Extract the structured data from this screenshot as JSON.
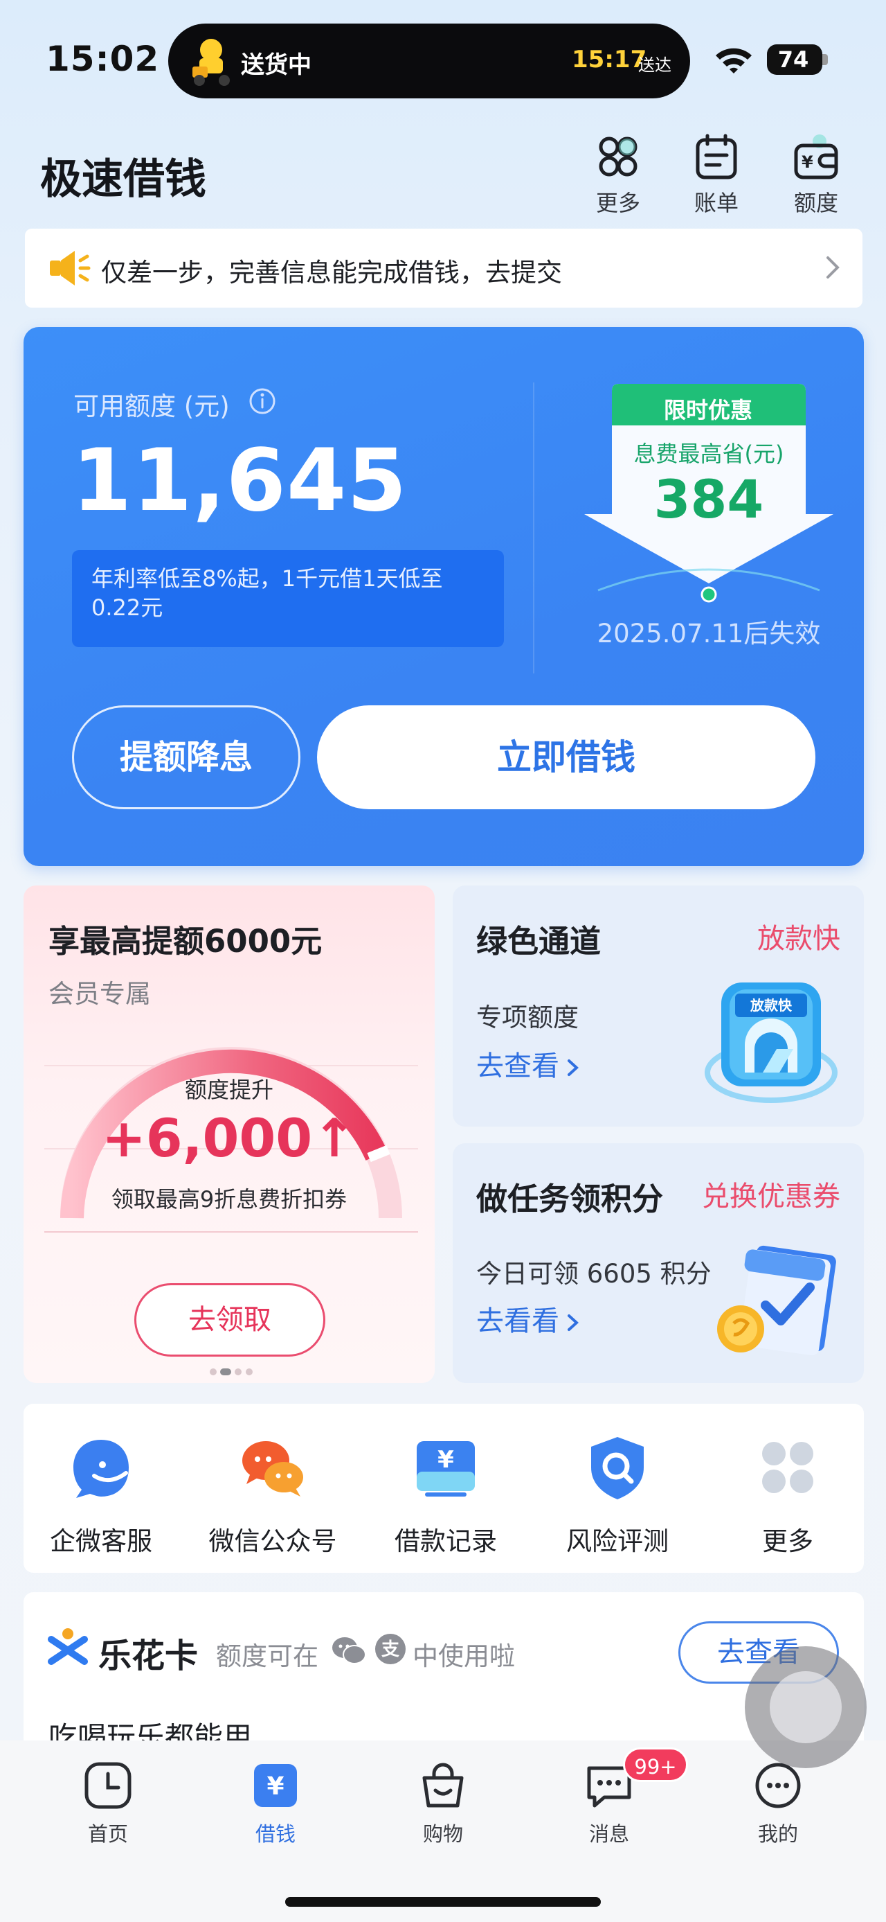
{
  "status_bar": {
    "time": "15:02",
    "island_label": "送货中",
    "island_eta": "15:17",
    "island_eta_suffix": "送达",
    "battery": "74"
  },
  "header": {
    "title": "极速借钱",
    "actions": [
      {
        "label": "更多",
        "icon": "more-circles-icon"
      },
      {
        "label": "账单",
        "icon": "bill-icon"
      },
      {
        "label": "额度",
        "icon": "wallet-icon"
      }
    ]
  },
  "notice": {
    "icon": "speaker-icon",
    "text": "仅差一步，完善信息能完成借钱，去提交"
  },
  "credit_card": {
    "label": "可用额度 (元)",
    "amount": "11,645",
    "rate_text": "年利率低至8%起，1千元借1天低至0.22元",
    "promo_tag": "限时优惠",
    "promo_sub": "息费最高省(元)",
    "promo_value": "384",
    "promo_expire": "2025.07.11后失效",
    "secondary_button": "提额降息",
    "primary_button": "立即借钱",
    "accent": "#3a84f3"
  },
  "promo_limit": {
    "title": "享最高提额6000元",
    "subtitle": "会员专属",
    "gauge_label": "额度提升",
    "gauge_value": "+6,000↑",
    "gauge_desc": "领取最高9折息费折扣券",
    "button": "去领取"
  },
  "green_channel": {
    "title": "绿色通道",
    "tag": "放款快",
    "subtitle": "专项额度",
    "link": "去查看",
    "art_text": "放款快"
  },
  "task_card": {
    "title": "做任务领积分",
    "tag": "兑换优惠券",
    "subtitle": "今日可领 6605 积分",
    "link": "去看看"
  },
  "shortcuts": [
    {
      "label": "企微客服",
      "icon": "service-icon"
    },
    {
      "label": "微信公众号",
      "icon": "wechat-official-icon"
    },
    {
      "label": "借款记录",
      "icon": "loan-record-icon"
    },
    {
      "label": "风险评测",
      "icon": "risk-shield-icon"
    },
    {
      "label": "更多",
      "icon": "more-grid-icon"
    }
  ],
  "lehua": {
    "title": "乐花卡",
    "desc_before": "额度可在",
    "desc_after": "中使用啦",
    "button": "去查看",
    "line": "吃喝玩乐都能用"
  },
  "tabbar": {
    "tabs": [
      {
        "label": "首页",
        "icon": "clock-home-icon"
      },
      {
        "label": "借钱",
        "icon": "yuan-icon"
      },
      {
        "label": "购物",
        "icon": "shopping-bag-icon"
      },
      {
        "label": "消息",
        "icon": "message-icon"
      },
      {
        "label": "我的",
        "icon": "profile-icon"
      }
    ],
    "active": "借钱",
    "message_badge": "99+"
  }
}
